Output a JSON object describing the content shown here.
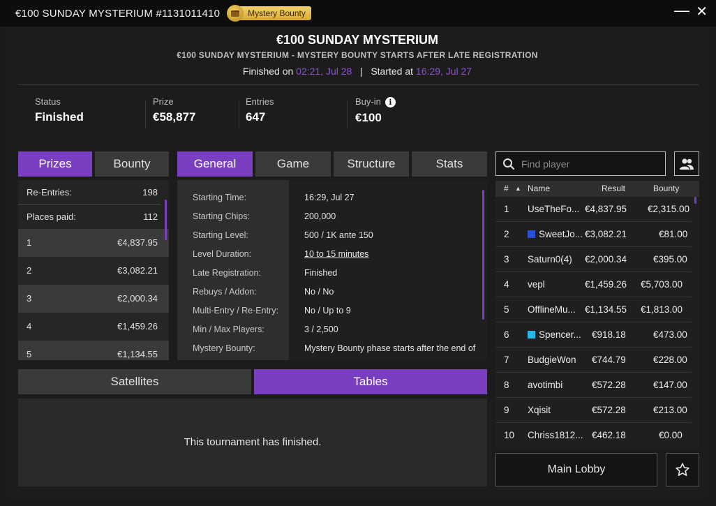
{
  "window": {
    "title": "€100 SUNDAY MYSTERIUM #1131011410",
    "badge": "Mystery Bounty",
    "minimize": "—",
    "close": "✕"
  },
  "header": {
    "title": "€100 SUNDAY MYSTERIUM",
    "subtitle": "€100 SUNDAY MYSTERIUM - MYSTERY BOUNTY STARTS AFTER LATE REGISTRATION",
    "finished_label": "Finished on",
    "finished_value": "02:21, Jul 28",
    "separator": "|",
    "started_label": "Started at",
    "started_value": "16:29, Jul 27"
  },
  "stats": {
    "status_label": "Status",
    "status_value": "Finished",
    "prize_label": "Prize",
    "prize_value": "€58,877",
    "entries_label": "Entries",
    "entries_value": "647",
    "buyin_label": "Buy-in",
    "buyin_value": "€100"
  },
  "left_tabs": {
    "prizes": "Prizes",
    "bounty": "Bounty"
  },
  "prizes": {
    "reentries_label": "Re-Entries:",
    "reentries_value": "198",
    "places_label": "Places paid:",
    "places_value": "112",
    "places": [
      {
        "place": "1",
        "amount": "€4,837.95"
      },
      {
        "place": "2",
        "amount": "€3,082.21"
      },
      {
        "place": "3",
        "amount": "€2,000.34"
      },
      {
        "place": "4",
        "amount": "€1,459.26"
      },
      {
        "place": "5",
        "amount": "€1,134.55"
      }
    ]
  },
  "mid_tabs": {
    "general": "General",
    "game": "Game",
    "structure": "Structure",
    "stats": "Stats"
  },
  "general": {
    "rows": [
      {
        "k": "Starting Time:",
        "v": "16:29, Jul 27"
      },
      {
        "k": "Starting Chips:",
        "v": "200,000"
      },
      {
        "k": "Starting Level:",
        "v": "500 / 1K ante 150"
      },
      {
        "k": "Level Duration:",
        "v": "10 to 15 minutes"
      },
      {
        "k": "Late Registration:",
        "v": "Finished"
      },
      {
        "k": "Rebuys / Addon:",
        "v": "No / No"
      },
      {
        "k": "Multi-Entry / Re-Entry:",
        "v": "No / Up to 9"
      },
      {
        "k": "Min / Max Players:",
        "v": "3 / 2,500"
      },
      {
        "k": "Mystery Bounty:",
        "v": "Mystery Bounty phase starts after the end of"
      }
    ]
  },
  "bottom_tabs": {
    "satellites": "Satellites",
    "tables": "Tables"
  },
  "bottom": {
    "message": "This tournament has finished."
  },
  "search": {
    "placeholder": "Find player"
  },
  "leaderboard": {
    "headers": {
      "num": "#",
      "sort": "▲",
      "name": "Name",
      "result": "Result",
      "bounty": "Bounty"
    },
    "rows": [
      {
        "rank": "1",
        "name": "UseTheFo...",
        "result": "€4,837.95",
        "bounty": "€2,315.00",
        "flag": ""
      },
      {
        "rank": "2",
        "name": "SweetJo...",
        "result": "€3,082.21",
        "bounty": "€81.00",
        "flag": "#2c4fd8"
      },
      {
        "rank": "3",
        "name": "Saturn0(4)",
        "result": "€2,000.34",
        "bounty": "€395.00",
        "flag": ""
      },
      {
        "rank": "4",
        "name": "vepl",
        "result": "€1,459.26",
        "bounty": "€5,703.00",
        "flag": ""
      },
      {
        "rank": "5",
        "name": "OfflineMu...",
        "result": "€1,134.55",
        "bounty": "€1,813.00",
        "flag": ""
      },
      {
        "rank": "6",
        "name": "Spencer...",
        "result": "€918.18",
        "bounty": "€473.00",
        "flag": "#29b6e8"
      },
      {
        "rank": "7",
        "name": "BudgieWon",
        "result": "€744.79",
        "bounty": "€228.00",
        "flag": ""
      },
      {
        "rank": "8",
        "name": "avotimbi",
        "result": "€572.28",
        "bounty": "€147.00",
        "flag": ""
      },
      {
        "rank": "9",
        "name": "Xqisit",
        "result": "€572.28",
        "bounty": "€213.00",
        "flag": ""
      },
      {
        "rank": "10",
        "name": "Chriss1812...",
        "result": "€462.18",
        "bounty": "€0.00",
        "flag": ""
      }
    ]
  },
  "footer": {
    "main_lobby": "Main Lobby"
  },
  "colors": {
    "accent": "#7a3fc0",
    "accent_text": "#8e4fd1",
    "badge_gold": "#e6b84a"
  }
}
